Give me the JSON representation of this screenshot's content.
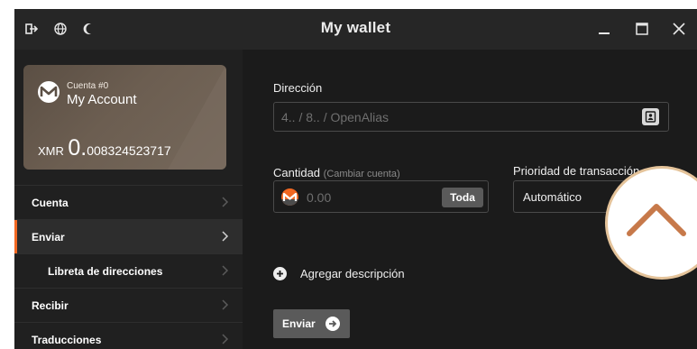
{
  "titlebar": {
    "title": "My wallet"
  },
  "account": {
    "number_label": "Cuenta #0",
    "name": "My Account",
    "currency": "XMR",
    "balance_integer": "0.",
    "balance_fraction": "008324523717"
  },
  "menu": [
    {
      "label": "Cuenta",
      "active": false
    },
    {
      "label": "Enviar",
      "active": true
    },
    {
      "label": "Libreta de direcciones",
      "active": false,
      "sub": true
    },
    {
      "label": "Recibir",
      "active": false
    },
    {
      "label": "Traducciones",
      "active": false
    }
  ],
  "send": {
    "address_label": "Dirección",
    "address_placeholder": "4.. / 8.. / OpenAlias",
    "amount_label": "Cantidad",
    "amount_sub": "(Cambiar cuenta)",
    "amount_value": "0.00",
    "all_button": "Toda",
    "priority_label": "Prioridad de transacción",
    "priority_value": "Automático",
    "add_description": "Agregar descripción",
    "send_button": "Enviar"
  },
  "colors": {
    "accent": "#f26822",
    "window_bg": "#1b1b1b"
  },
  "icons": [
    "exit-icon",
    "globe-icon",
    "moon-icon",
    "minimize-icon",
    "maximize-icon",
    "close-icon",
    "monero-logo-icon",
    "chevron-right-icon",
    "address-book-icon",
    "plus-icon",
    "arrow-right-icon",
    "chevron-up-icon"
  ]
}
